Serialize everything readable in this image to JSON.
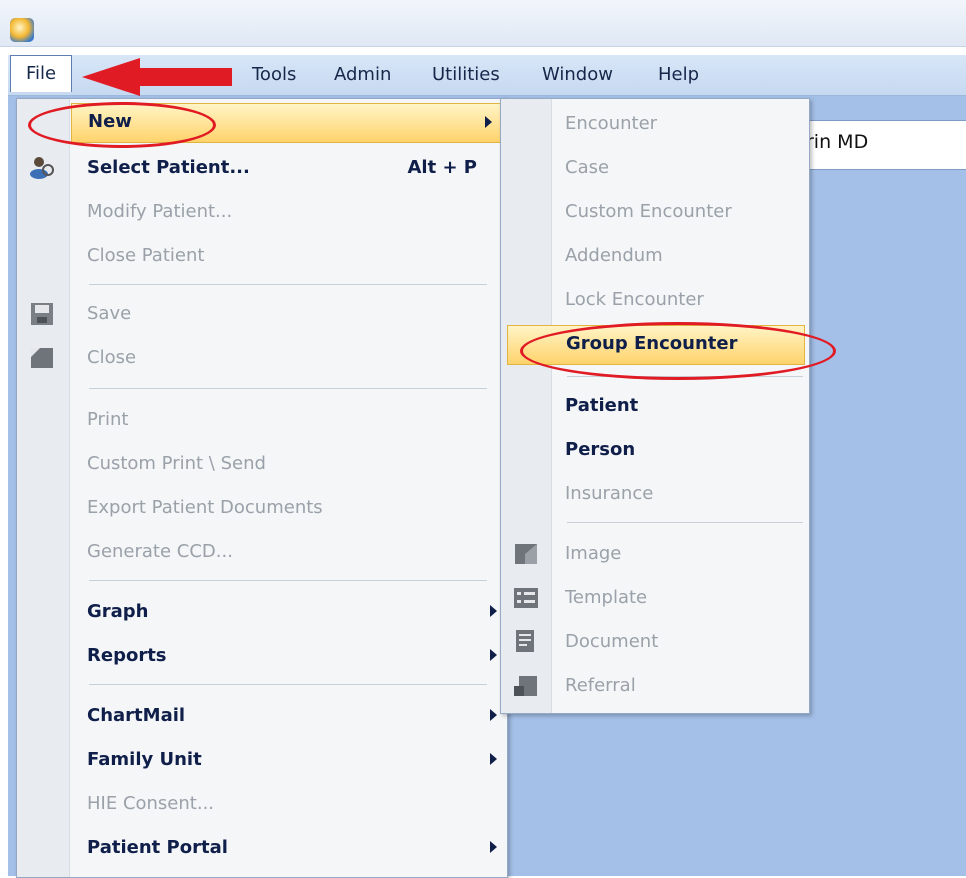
{
  "menubar": {
    "file": "File",
    "items": [
      "Tools",
      "Admin",
      "Utilities",
      "Window",
      "Help"
    ]
  },
  "provider_fragment": "rin MD",
  "file_menu": {
    "items": [
      {
        "label": "New",
        "state": "highlighted"
      },
      {
        "label": "Select Patient...",
        "shortcut": "Alt + P",
        "state": "enabled"
      },
      {
        "label": "Modify Patient...",
        "state": "disabled"
      },
      {
        "label": "Close Patient",
        "state": "disabled"
      },
      {
        "label": "Save",
        "state": "disabled"
      },
      {
        "label": "Close",
        "state": "disabled"
      },
      {
        "label": "Print",
        "state": "disabled"
      },
      {
        "label": "Custom Print \\ Send",
        "state": "disabled"
      },
      {
        "label": "Export Patient Documents",
        "state": "disabled"
      },
      {
        "label": "Generate CCD...",
        "state": "disabled"
      },
      {
        "label": "Graph",
        "state": "enabled"
      },
      {
        "label": "Reports",
        "state": "enabled"
      },
      {
        "label": "ChartMail",
        "state": "enabled"
      },
      {
        "label": "Family Unit",
        "state": "enabled"
      },
      {
        "label": "HIE Consent...",
        "state": "disabled"
      },
      {
        "label": "Patient Portal",
        "state": "enabled"
      }
    ]
  },
  "new_submenu": {
    "items": [
      {
        "label": "Encounter",
        "state": "disabled"
      },
      {
        "label": "Case",
        "state": "disabled"
      },
      {
        "label": "Custom Encounter",
        "state": "disabled"
      },
      {
        "label": "Addendum",
        "state": "disabled"
      },
      {
        "label": "Lock Encounter",
        "state": "disabled"
      },
      {
        "label": "Group Encounter",
        "state": "highlighted"
      },
      {
        "label": "Patient",
        "state": "enabled"
      },
      {
        "label": "Person",
        "state": "enabled"
      },
      {
        "label": "Insurance",
        "state": "disabled"
      },
      {
        "label": "Image",
        "state": "disabled"
      },
      {
        "label": "Template",
        "state": "disabled"
      },
      {
        "label": "Document",
        "state": "disabled"
      },
      {
        "label": "Referral",
        "state": "disabled"
      }
    ]
  },
  "colors": {
    "annotation_red": "#e01b24",
    "highlight": "#ffd36b",
    "workspace": "#a4c0e8"
  }
}
